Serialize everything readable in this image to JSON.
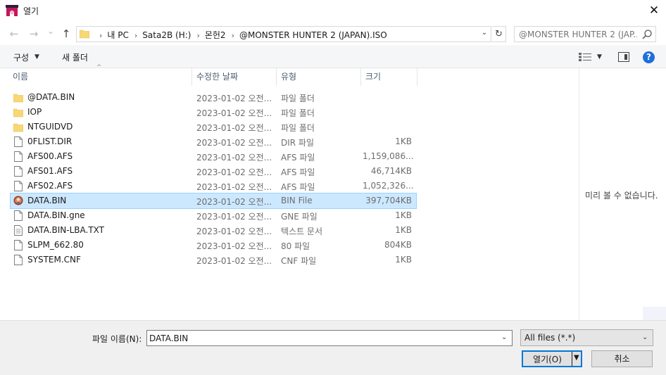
{
  "window": {
    "title": "열기",
    "close_glyph": "✕",
    "icon": "app-icon"
  },
  "nav": {
    "back_glyph": "←",
    "forward_glyph": "→",
    "recent_glyph": "⌄",
    "up_glyph": "↑",
    "breadcrumb": [
      "내 PC",
      "Sata2B (H:)",
      "몬헌2",
      "@MONSTER HUNTER 2 (JAPAN).ISO"
    ],
    "breadcrumb_sep": "›",
    "address_dropdown_glyph": "⌄",
    "refresh_glyph": "↻",
    "search_placeholder": "@MONSTER HUNTER 2 (JAP..."
  },
  "toolbar": {
    "organize_label": "구성",
    "organize_caret": "▼",
    "new_folder_label": "새 폴더",
    "view_caret": "▼",
    "help_label": "?"
  },
  "columns": {
    "name": "이름",
    "date": "수정한 날짜",
    "type": "유형",
    "size": "크기",
    "sort_arrow": "^"
  },
  "files": [
    {
      "name": "@DATA.BIN",
      "date": "2023-01-02 오전...",
      "type": "파일 폴더",
      "size": "",
      "icon": "folder-icon"
    },
    {
      "name": "IOP",
      "date": "2023-01-02 오전...",
      "type": "파일 폴더",
      "size": "",
      "icon": "folder-icon"
    },
    {
      "name": "NTGUIDVD",
      "date": "2023-01-02 오전...",
      "type": "파일 폴더",
      "size": "",
      "icon": "folder-icon"
    },
    {
      "name": "0FLIST.DIR",
      "date": "2023-01-02 오전...",
      "type": "DIR 파일",
      "size": "1KB",
      "icon": "file-icon"
    },
    {
      "name": "AFS00.AFS",
      "date": "2023-01-02 오전...",
      "type": "AFS 파일",
      "size": "1,159,086...",
      "icon": "file-icon"
    },
    {
      "name": "AFS01.AFS",
      "date": "2023-01-02 오전...",
      "type": "AFS 파일",
      "size": "46,714KB",
      "icon": "file-icon"
    },
    {
      "name": "AFS02.AFS",
      "date": "2023-01-02 오전...",
      "type": "AFS 파일",
      "size": "1,052,326...",
      "icon": "file-icon"
    },
    {
      "name": "DATA.BIN",
      "date": "2023-01-02 오전...",
      "type": "BIN File",
      "size": "397,704KB",
      "icon": "bin-icon",
      "selected": true
    },
    {
      "name": "DATA.BIN.gne",
      "date": "2023-01-02 오전...",
      "type": "GNE 파일",
      "size": "1KB",
      "icon": "file-icon"
    },
    {
      "name": "DATA.BIN-LBA.TXT",
      "date": "2023-01-02 오전...",
      "type": "텍스트 문서",
      "size": "1KB",
      "icon": "text-file-icon"
    },
    {
      "name": "SLPM_662.80",
      "date": "2023-01-02 오전...",
      "type": "80 파일",
      "size": "804KB",
      "icon": "file-icon"
    },
    {
      "name": "SYSTEM.CNF",
      "date": "2023-01-02 오전...",
      "type": "CNF 파일",
      "size": "1KB",
      "icon": "file-icon"
    }
  ],
  "preview": {
    "message": "미리 볼 수 없습니다."
  },
  "bottom": {
    "filename_label": "파일 이름(N):",
    "filename_value": "DATA.BIN",
    "filename_dropdown_glyph": "⌄",
    "filter_value": "All files (*.*)",
    "filter_dropdown_glyph": "⌄",
    "open_label": "열기(O)",
    "open_caret": "▼",
    "cancel_label": "취소"
  },
  "colors": {
    "selection_bg": "#cce8ff",
    "selection_border": "#99d1ff",
    "folder_yellow": "#f8d775",
    "accent_blue": "#0078d7",
    "help_blue": "#1e6fd9"
  }
}
